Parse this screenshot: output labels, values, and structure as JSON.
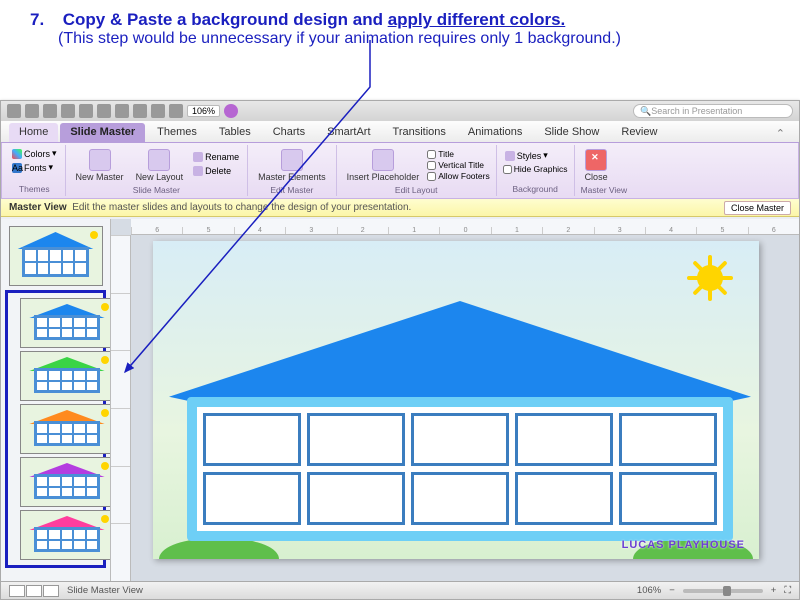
{
  "instruction": {
    "number": "7.",
    "title_lead": "Copy & Paste a background design and ",
    "title_underlined": "apply different colors.",
    "subtitle": "(This step would be unnecessary if your animation requires only 1 background.)"
  },
  "app": {
    "zoom_toolbar": "106%",
    "search_placeholder": "Search in Presentation"
  },
  "ribbon_tabs": [
    "Home",
    "Slide Master",
    "Themes",
    "Tables",
    "Charts",
    "SmartArt",
    "Transitions",
    "Animations",
    "Slide Show",
    "Review"
  ],
  "active_tab": "Slide Master",
  "ribbon_groups": {
    "themes": {
      "label": "Themes",
      "colors": "Colors",
      "fonts": "Fonts"
    },
    "slide_master": {
      "label": "Slide Master",
      "new_master": "New Master",
      "new_layout": "New Layout",
      "rename": "Rename",
      "delete": "Delete"
    },
    "edit_master": {
      "label": "Edit Master",
      "master_elements": "Master Elements"
    },
    "edit_layout": {
      "label": "Edit Layout",
      "insert_placeholder": "Insert Placeholder",
      "title": "Title",
      "vertical_title": "Vertical Title",
      "allow_footers": "Allow Footers"
    },
    "background": {
      "label": "Background",
      "styles": "Styles",
      "hide_graphics": "Hide Graphics"
    },
    "master_view": {
      "label": "Master View",
      "close": "Close"
    }
  },
  "infobar": {
    "mode": "Master View",
    "hint": "Edit the master slides and layouts to change the design of your presentation.",
    "close_master": "Close Master"
  },
  "ruler_marks": [
    "6",
    "5",
    "4",
    "3",
    "2",
    "1",
    "0",
    "1",
    "2",
    "3",
    "4",
    "5",
    "6"
  ],
  "thumbs": [
    {
      "roof": "#1c86ee",
      "type": "master"
    },
    {
      "roof": "#1c86ee",
      "type": "layout"
    },
    {
      "roof": "#3ad445",
      "type": "layout"
    },
    {
      "roof": "#ff8a1f",
      "type": "layout"
    },
    {
      "roof": "#b43de0",
      "type": "layout"
    },
    {
      "roof": "#ff3d9e",
      "type": "layout"
    }
  ],
  "main_slide": {
    "roof": "#1c86ee",
    "logo": "LUCAS PLAYHOUSE"
  },
  "statusbar": {
    "mode": "Slide Master View",
    "zoom": "106%"
  }
}
